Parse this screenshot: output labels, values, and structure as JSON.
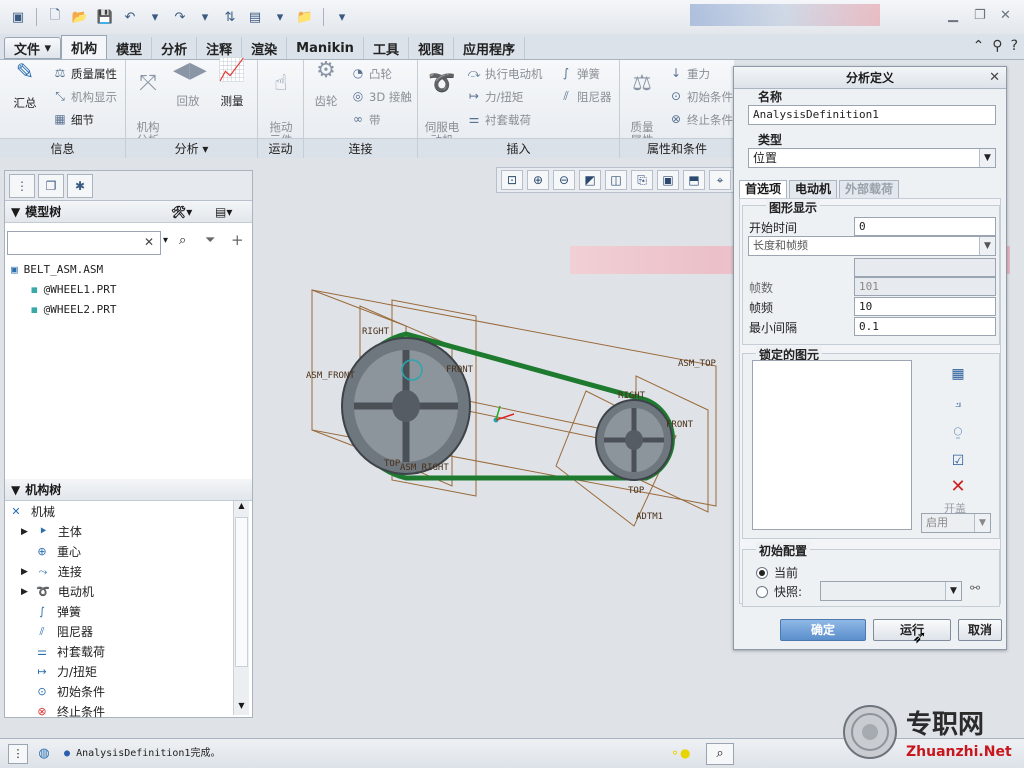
{
  "ribbon_tabs": [
    "文件",
    "机构",
    "模型",
    "分析",
    "注释",
    "渲染",
    "Manikin",
    "工具",
    "视图",
    "应用程序"
  ],
  "ribbon": {
    "info": {
      "label": "信息",
      "summary": "汇总",
      "mass_props": "质量属性",
      "mech_display": "机构显示",
      "detail": "细节"
    },
    "analysis": {
      "label": "分析",
      "mech_analysis": "机构\n分析",
      "playback": "回放",
      "measure": "测量"
    },
    "motion": {
      "label": "运动",
      "drag": "拖动\n元件"
    },
    "connect": {
      "label": "连接",
      "gear": "齿轮",
      "cam": "凸轮",
      "contact3d": "3D 接触",
      "belt": "带"
    },
    "insert": {
      "label": "插入",
      "servo": "伺服电\n动机",
      "exec_motor": "执行电动机",
      "force": "力/扭矩",
      "bushing": "衬套载荷",
      "spring": "弹簧",
      "damper": "阻尼器"
    },
    "props": {
      "label": "属性和条件",
      "mass": "质量\n属性",
      "gravity": "重力",
      "init_cond": "初始条件",
      "term_cond": "终止条件"
    }
  },
  "model_tree": {
    "title": "模型树",
    "items": [
      "BELT_ASM.ASM",
      "@WHEEL1.PRT",
      "@WHEEL2.PRT"
    ]
  },
  "mech_tree": {
    "title": "机构树",
    "root": "机械",
    "items": [
      "主体",
      "重心",
      "连接",
      "电动机",
      "弹簧",
      "阻尼器",
      "衬套载荷",
      "力/扭矩",
      "初始条件",
      "终止条件"
    ]
  },
  "canvas_labels": {
    "right1": "RIGHT",
    "asm_front": "ASM_FRONT",
    "front1": "FRONT",
    "top1": "TOP",
    "asm_right": "ASM_RIGHT",
    "asm_top": "ASM_TOP",
    "right2": "RIGHT",
    "front2": "FRONT",
    "top2": "TOP",
    "adtm1": "ADTM1"
  },
  "dialog": {
    "title": "分析定义",
    "name_label": "名称",
    "name_value": "AnalysisDefinition1",
    "type_label": "类型",
    "type_value": "位置",
    "tabs": [
      "首选项",
      "电动机",
      "外部载荷"
    ],
    "graph_label": "图形显示",
    "start_time_label": "开始时间",
    "start_time_value": "0",
    "mode_value": "长度和帧频",
    "frames_label": "帧数",
    "frames_value": "101",
    "frame_rate_label": "帧频",
    "frame_rate_value": "10",
    "min_interval_label": "最小间隔",
    "min_interval_value": "0.1",
    "locked_label": "锁定的图元",
    "enable_label": "启用",
    "open_label": "开盖",
    "init_label": "初始配置",
    "current_label": "当前",
    "snapshot_label": "快照:",
    "ok": "确定",
    "run": "运行",
    "cancel": "取消"
  },
  "status": {
    "message": "AnalysisDefinition1完成。"
  },
  "watermark": {
    "cn": "专职网",
    "url": "Zhuanzhi.Net"
  },
  "colors": {
    "belt": "#1e7a2e",
    "frame": "#9a6a3a",
    "wheel": "#6e767e",
    "accent": "#5b8fcc"
  }
}
